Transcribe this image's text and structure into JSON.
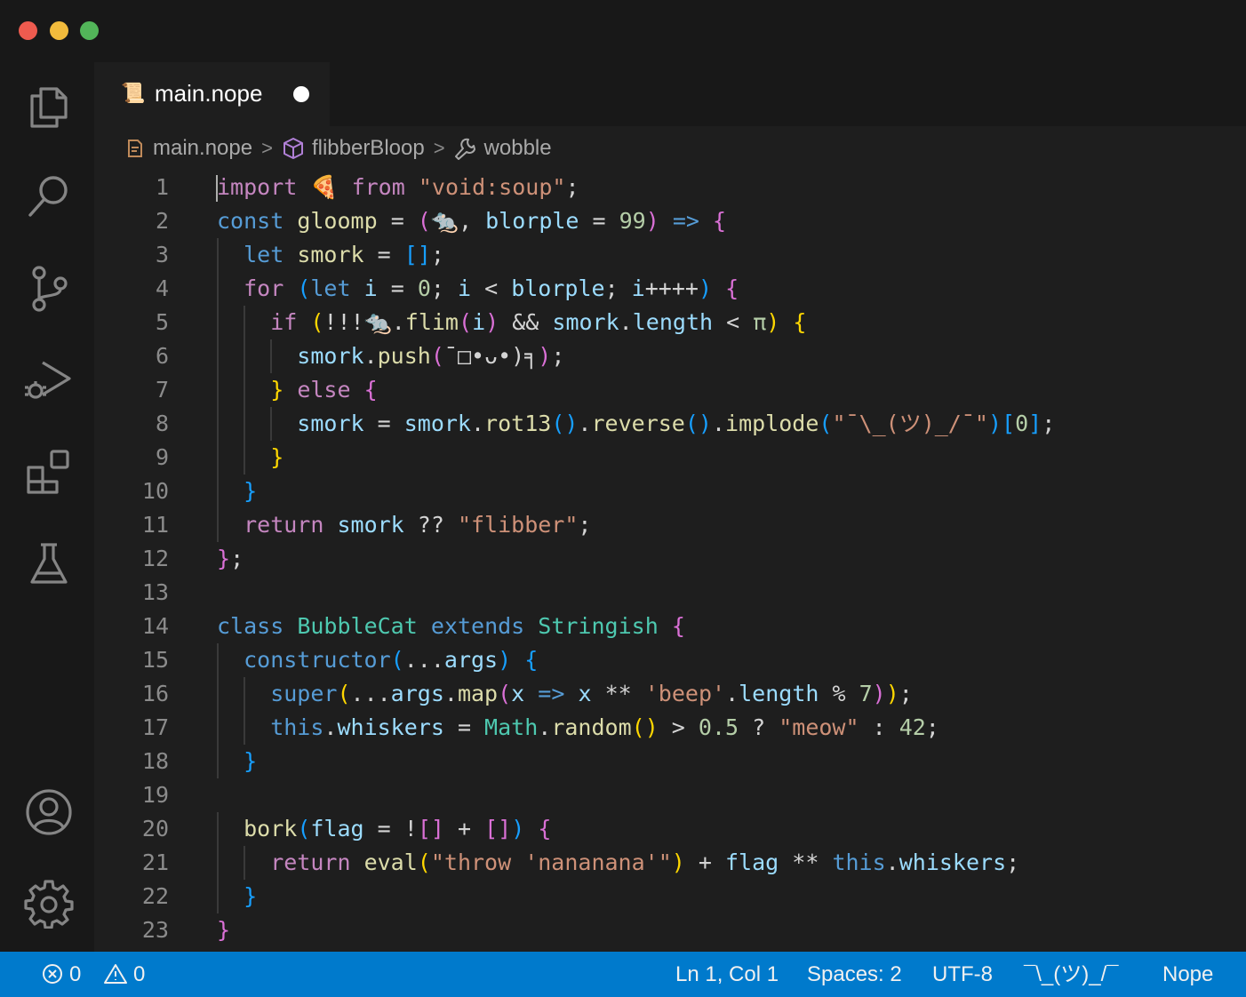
{
  "tab": {
    "icon": "📜",
    "label": "main.nope",
    "modified": true
  },
  "breadcrumb": [
    {
      "icon": "file-icon",
      "label": "main.nope"
    },
    {
      "icon": "cube-icon",
      "label": "flibberBloop"
    },
    {
      "icon": "wrench-icon",
      "label": "wobble"
    }
  ],
  "activity_bar": [
    "explorer-icon",
    "search-icon",
    "source-control-icon",
    "run-debug-icon",
    "extensions-icon",
    "testing-icon",
    "account-icon",
    "settings-gear-icon"
  ],
  "editor": {
    "lines": [
      {
        "n": "1",
        "indent": 0,
        "tokens": [
          [
            "kw",
            "import"
          ],
          [
            "pn",
            " "
          ],
          [
            "em",
            "🍕"
          ],
          [
            "pn",
            " "
          ],
          [
            "kw",
            "from"
          ],
          [
            "pn",
            " "
          ],
          [
            "st",
            "\"void:soup\""
          ],
          [
            "pn",
            ";"
          ]
        ]
      },
      {
        "n": "2",
        "indent": 0,
        "tokens": [
          [
            "dk",
            "const"
          ],
          [
            "pn",
            " "
          ],
          [
            "fn",
            "gloomp"
          ],
          [
            "pn",
            " = "
          ],
          [
            "b2",
            "("
          ],
          [
            "vr",
            "🐀"
          ],
          [
            "pn",
            ", "
          ],
          [
            "vr",
            "blorple"
          ],
          [
            "pn",
            " = "
          ],
          [
            "nm",
            "99"
          ],
          [
            "b2",
            ")"
          ],
          [
            "pn",
            " "
          ],
          [
            "dk",
            "=>"
          ],
          [
            "pn",
            " "
          ],
          [
            "b2",
            "{"
          ]
        ]
      },
      {
        "n": "3",
        "indent": 1,
        "tokens": [
          [
            "dk",
            "let"
          ],
          [
            "pn",
            " "
          ],
          [
            "fn",
            "smork"
          ],
          [
            "pn",
            " = "
          ],
          [
            "b3",
            "[]"
          ],
          [
            "pn",
            ";"
          ]
        ]
      },
      {
        "n": "4",
        "indent": 1,
        "tokens": [
          [
            "kw",
            "for"
          ],
          [
            "pn",
            " "
          ],
          [
            "b3",
            "("
          ],
          [
            "dk",
            "let"
          ],
          [
            "pn",
            " "
          ],
          [
            "vr",
            "i"
          ],
          [
            "pn",
            " = "
          ],
          [
            "nm",
            "0"
          ],
          [
            "pn",
            "; "
          ],
          [
            "vr",
            "i"
          ],
          [
            "pn",
            " < "
          ],
          [
            "vr",
            "blorple"
          ],
          [
            "pn",
            "; "
          ],
          [
            "vr",
            "i"
          ],
          [
            "pn",
            "++++"
          ],
          [
            "b3",
            ")"
          ],
          [
            "pn",
            " "
          ],
          [
            "b2",
            "{"
          ]
        ]
      },
      {
        "n": "5",
        "indent": 2,
        "tokens": [
          [
            "kw",
            "if"
          ],
          [
            "pn",
            " "
          ],
          [
            "b1",
            "("
          ],
          [
            "pn",
            "!!!"
          ],
          [
            "vr",
            "🐀"
          ],
          [
            "pn",
            "."
          ],
          [
            "fn",
            "flim"
          ],
          [
            "b2",
            "("
          ],
          [
            "vr",
            "i"
          ],
          [
            "b2",
            ")"
          ],
          [
            "pn",
            " && "
          ],
          [
            "vr",
            "smork"
          ],
          [
            "pn",
            "."
          ],
          [
            "vr",
            "length"
          ],
          [
            "pn",
            " < "
          ],
          [
            "nm",
            "π"
          ],
          [
            "b1",
            ")"
          ],
          [
            "pn",
            " "
          ],
          [
            "b1",
            "{"
          ]
        ]
      },
      {
        "n": "6",
        "indent": 3,
        "tokens": [
          [
            "vr",
            "smork"
          ],
          [
            "pn",
            "."
          ],
          [
            "fn",
            "push"
          ],
          [
            "b2",
            "("
          ],
          [
            "pn",
            "¯□•ᴗ•)╕"
          ],
          [
            "b2",
            ")"
          ],
          [
            "pn",
            ";"
          ]
        ]
      },
      {
        "n": "7",
        "indent": 2,
        "tokens": [
          [
            "b1",
            "}"
          ],
          [
            "pn",
            " "
          ],
          [
            "kw",
            "else"
          ],
          [
            "pn",
            " "
          ],
          [
            "b2",
            "{"
          ]
        ]
      },
      {
        "n": "8",
        "indent": 3,
        "tokens": [
          [
            "vr",
            "smork"
          ],
          [
            "pn",
            " = "
          ],
          [
            "vr",
            "smork"
          ],
          [
            "pn",
            "."
          ],
          [
            "fn",
            "rot13"
          ],
          [
            "b3",
            "()"
          ],
          [
            "pn",
            "."
          ],
          [
            "fn",
            "reverse"
          ],
          [
            "b3",
            "()"
          ],
          [
            "pn",
            "."
          ],
          [
            "fn",
            "implode"
          ],
          [
            "b3",
            "("
          ],
          [
            "st",
            "\"¯\\_(ツ)_/¯\""
          ],
          [
            "b3",
            ")"
          ],
          [
            "b3",
            "["
          ],
          [
            "nm",
            "0"
          ],
          [
            "b3",
            "]"
          ],
          [
            "pn",
            ";"
          ]
        ]
      },
      {
        "n": "9",
        "indent": 2,
        "tokens": [
          [
            "b1",
            "}"
          ]
        ]
      },
      {
        "n": "10",
        "indent": 1,
        "tokens": [
          [
            "b3",
            "}"
          ]
        ]
      },
      {
        "n": "11",
        "indent": 1,
        "tokens": [
          [
            "kw",
            "return"
          ],
          [
            "pn",
            " "
          ],
          [
            "vr",
            "smork"
          ],
          [
            "pn",
            " ?? "
          ],
          [
            "st",
            "\"flibber\""
          ],
          [
            "pn",
            ";"
          ]
        ]
      },
      {
        "n": "12",
        "indent": 0,
        "tokens": [
          [
            "b2",
            "}"
          ],
          [
            "pn",
            ";"
          ]
        ]
      },
      {
        "n": "13",
        "indent": 0,
        "tokens": []
      },
      {
        "n": "14",
        "indent": 0,
        "tokens": [
          [
            "dk",
            "class"
          ],
          [
            "pn",
            " "
          ],
          [
            "ty",
            "BubbleCat"
          ],
          [
            "pn",
            " "
          ],
          [
            "dk",
            "extends"
          ],
          [
            "pn",
            " "
          ],
          [
            "ty",
            "Stringish"
          ],
          [
            "pn",
            " "
          ],
          [
            "b2",
            "{"
          ]
        ]
      },
      {
        "n": "15",
        "indent": 1,
        "tokens": [
          [
            "dk",
            "constructor"
          ],
          [
            "b3",
            "("
          ],
          [
            "pn",
            "..."
          ],
          [
            "vr",
            "args"
          ],
          [
            "b3",
            ")"
          ],
          [
            "pn",
            " "
          ],
          [
            "b3",
            "{"
          ]
        ]
      },
      {
        "n": "16",
        "indent": 2,
        "tokens": [
          [
            "dk",
            "super"
          ],
          [
            "b1",
            "("
          ],
          [
            "pn",
            "..."
          ],
          [
            "vr",
            "args"
          ],
          [
            "pn",
            "."
          ],
          [
            "fn",
            "map"
          ],
          [
            "b2",
            "("
          ],
          [
            "vr",
            "x"
          ],
          [
            "pn",
            " "
          ],
          [
            "dk",
            "=>"
          ],
          [
            "pn",
            " "
          ],
          [
            "vr",
            "x"
          ],
          [
            "pn",
            " ** "
          ],
          [
            "st",
            "'beep'"
          ],
          [
            "pn",
            "."
          ],
          [
            "vr",
            "length"
          ],
          [
            "pn",
            " % "
          ],
          [
            "nm",
            "7"
          ],
          [
            "b2",
            ")"
          ],
          [
            "b1",
            ")"
          ],
          [
            "pn",
            ";"
          ]
        ]
      },
      {
        "n": "17",
        "indent": 2,
        "tokens": [
          [
            "dk",
            "this"
          ],
          [
            "pn",
            "."
          ],
          [
            "vr",
            "whiskers"
          ],
          [
            "pn",
            " = "
          ],
          [
            "ty",
            "Math"
          ],
          [
            "pn",
            "."
          ],
          [
            "fn",
            "random"
          ],
          [
            "b1",
            "()"
          ],
          [
            "pn",
            " > "
          ],
          [
            "nm",
            "0.5"
          ],
          [
            "pn",
            " ? "
          ],
          [
            "st",
            "\"meow\""
          ],
          [
            "pn",
            " : "
          ],
          [
            "nm",
            "42"
          ],
          [
            "pn",
            ";"
          ]
        ]
      },
      {
        "n": "18",
        "indent": 1,
        "tokens": [
          [
            "b3",
            "}"
          ]
        ]
      },
      {
        "n": "19",
        "indent": 0,
        "tokens": []
      },
      {
        "n": "20",
        "indent": 1,
        "tokens": [
          [
            "fn",
            "bork"
          ],
          [
            "b3",
            "("
          ],
          [
            "vr",
            "flag"
          ],
          [
            "pn",
            " = !"
          ],
          [
            "b2",
            "[]"
          ],
          [
            "pn",
            " + "
          ],
          [
            "b2",
            "[]"
          ],
          [
            "b3",
            ")"
          ],
          [
            "pn",
            " "
          ],
          [
            "b2",
            "{"
          ]
        ]
      },
      {
        "n": "21",
        "indent": 2,
        "tokens": [
          [
            "kw",
            "return"
          ],
          [
            "pn",
            " "
          ],
          [
            "fn",
            "eval"
          ],
          [
            "b1",
            "("
          ],
          [
            "st",
            "\"throw 'nananana'\""
          ],
          [
            "b1",
            ")"
          ],
          [
            "pn",
            " + "
          ],
          [
            "vr",
            "flag"
          ],
          [
            "pn",
            " ** "
          ],
          [
            "dk",
            "this"
          ],
          [
            "pn",
            "."
          ],
          [
            "vr",
            "whiskers"
          ],
          [
            "pn",
            ";"
          ]
        ]
      },
      {
        "n": "22",
        "indent": 1,
        "tokens": [
          [
            "b3",
            "}"
          ]
        ]
      },
      {
        "n": "23",
        "indent": 0,
        "tokens": [
          [
            "b2",
            "}"
          ]
        ]
      }
    ]
  },
  "status": {
    "errors": "0",
    "warnings": "0",
    "position": "Ln 1, Col 1",
    "spaces": "Spaces: 2",
    "encoding": "UTF-8",
    "eol": "¯\\_(ツ)_/¯",
    "language": "Nope"
  },
  "colors": {
    "status_bar": "#007acc",
    "editor_bg": "#1e1e1e",
    "chrome_bg": "#181818"
  }
}
